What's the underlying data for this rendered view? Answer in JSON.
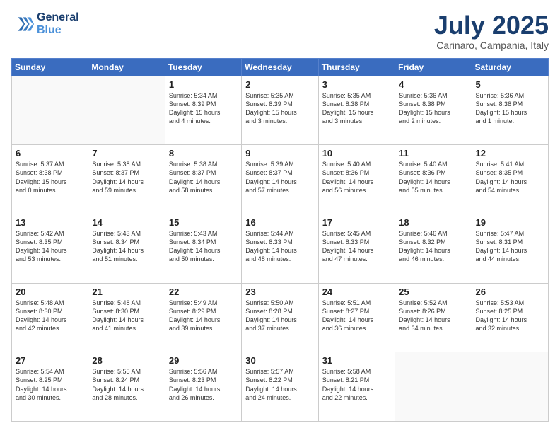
{
  "header": {
    "logo_line1": "General",
    "logo_line2": "Blue",
    "month_title": "July 2025",
    "location": "Carinaro, Campania, Italy"
  },
  "days_of_week": [
    "Sunday",
    "Monday",
    "Tuesday",
    "Wednesday",
    "Thursday",
    "Friday",
    "Saturday"
  ],
  "weeks": [
    [
      {
        "day": "",
        "info": ""
      },
      {
        "day": "",
        "info": ""
      },
      {
        "day": "1",
        "info": "Sunrise: 5:34 AM\nSunset: 8:39 PM\nDaylight: 15 hours\nand 4 minutes."
      },
      {
        "day": "2",
        "info": "Sunrise: 5:35 AM\nSunset: 8:39 PM\nDaylight: 15 hours\nand 3 minutes."
      },
      {
        "day": "3",
        "info": "Sunrise: 5:35 AM\nSunset: 8:38 PM\nDaylight: 15 hours\nand 3 minutes."
      },
      {
        "day": "4",
        "info": "Sunrise: 5:36 AM\nSunset: 8:38 PM\nDaylight: 15 hours\nand 2 minutes."
      },
      {
        "day": "5",
        "info": "Sunrise: 5:36 AM\nSunset: 8:38 PM\nDaylight: 15 hours\nand 1 minute."
      }
    ],
    [
      {
        "day": "6",
        "info": "Sunrise: 5:37 AM\nSunset: 8:38 PM\nDaylight: 15 hours\nand 0 minutes."
      },
      {
        "day": "7",
        "info": "Sunrise: 5:38 AM\nSunset: 8:37 PM\nDaylight: 14 hours\nand 59 minutes."
      },
      {
        "day": "8",
        "info": "Sunrise: 5:38 AM\nSunset: 8:37 PM\nDaylight: 14 hours\nand 58 minutes."
      },
      {
        "day": "9",
        "info": "Sunrise: 5:39 AM\nSunset: 8:37 PM\nDaylight: 14 hours\nand 57 minutes."
      },
      {
        "day": "10",
        "info": "Sunrise: 5:40 AM\nSunset: 8:36 PM\nDaylight: 14 hours\nand 56 minutes."
      },
      {
        "day": "11",
        "info": "Sunrise: 5:40 AM\nSunset: 8:36 PM\nDaylight: 14 hours\nand 55 minutes."
      },
      {
        "day": "12",
        "info": "Sunrise: 5:41 AM\nSunset: 8:35 PM\nDaylight: 14 hours\nand 54 minutes."
      }
    ],
    [
      {
        "day": "13",
        "info": "Sunrise: 5:42 AM\nSunset: 8:35 PM\nDaylight: 14 hours\nand 53 minutes."
      },
      {
        "day": "14",
        "info": "Sunrise: 5:43 AM\nSunset: 8:34 PM\nDaylight: 14 hours\nand 51 minutes."
      },
      {
        "day": "15",
        "info": "Sunrise: 5:43 AM\nSunset: 8:34 PM\nDaylight: 14 hours\nand 50 minutes."
      },
      {
        "day": "16",
        "info": "Sunrise: 5:44 AM\nSunset: 8:33 PM\nDaylight: 14 hours\nand 48 minutes."
      },
      {
        "day": "17",
        "info": "Sunrise: 5:45 AM\nSunset: 8:33 PM\nDaylight: 14 hours\nand 47 minutes."
      },
      {
        "day": "18",
        "info": "Sunrise: 5:46 AM\nSunset: 8:32 PM\nDaylight: 14 hours\nand 46 minutes."
      },
      {
        "day": "19",
        "info": "Sunrise: 5:47 AM\nSunset: 8:31 PM\nDaylight: 14 hours\nand 44 minutes."
      }
    ],
    [
      {
        "day": "20",
        "info": "Sunrise: 5:48 AM\nSunset: 8:30 PM\nDaylight: 14 hours\nand 42 minutes."
      },
      {
        "day": "21",
        "info": "Sunrise: 5:48 AM\nSunset: 8:30 PM\nDaylight: 14 hours\nand 41 minutes."
      },
      {
        "day": "22",
        "info": "Sunrise: 5:49 AM\nSunset: 8:29 PM\nDaylight: 14 hours\nand 39 minutes."
      },
      {
        "day": "23",
        "info": "Sunrise: 5:50 AM\nSunset: 8:28 PM\nDaylight: 14 hours\nand 37 minutes."
      },
      {
        "day": "24",
        "info": "Sunrise: 5:51 AM\nSunset: 8:27 PM\nDaylight: 14 hours\nand 36 minutes."
      },
      {
        "day": "25",
        "info": "Sunrise: 5:52 AM\nSunset: 8:26 PM\nDaylight: 14 hours\nand 34 minutes."
      },
      {
        "day": "26",
        "info": "Sunrise: 5:53 AM\nSunset: 8:25 PM\nDaylight: 14 hours\nand 32 minutes."
      }
    ],
    [
      {
        "day": "27",
        "info": "Sunrise: 5:54 AM\nSunset: 8:25 PM\nDaylight: 14 hours\nand 30 minutes."
      },
      {
        "day": "28",
        "info": "Sunrise: 5:55 AM\nSunset: 8:24 PM\nDaylight: 14 hours\nand 28 minutes."
      },
      {
        "day": "29",
        "info": "Sunrise: 5:56 AM\nSunset: 8:23 PM\nDaylight: 14 hours\nand 26 minutes."
      },
      {
        "day": "30",
        "info": "Sunrise: 5:57 AM\nSunset: 8:22 PM\nDaylight: 14 hours\nand 24 minutes."
      },
      {
        "day": "31",
        "info": "Sunrise: 5:58 AM\nSunset: 8:21 PM\nDaylight: 14 hours\nand 22 minutes."
      },
      {
        "day": "",
        "info": ""
      },
      {
        "day": "",
        "info": ""
      }
    ]
  ]
}
